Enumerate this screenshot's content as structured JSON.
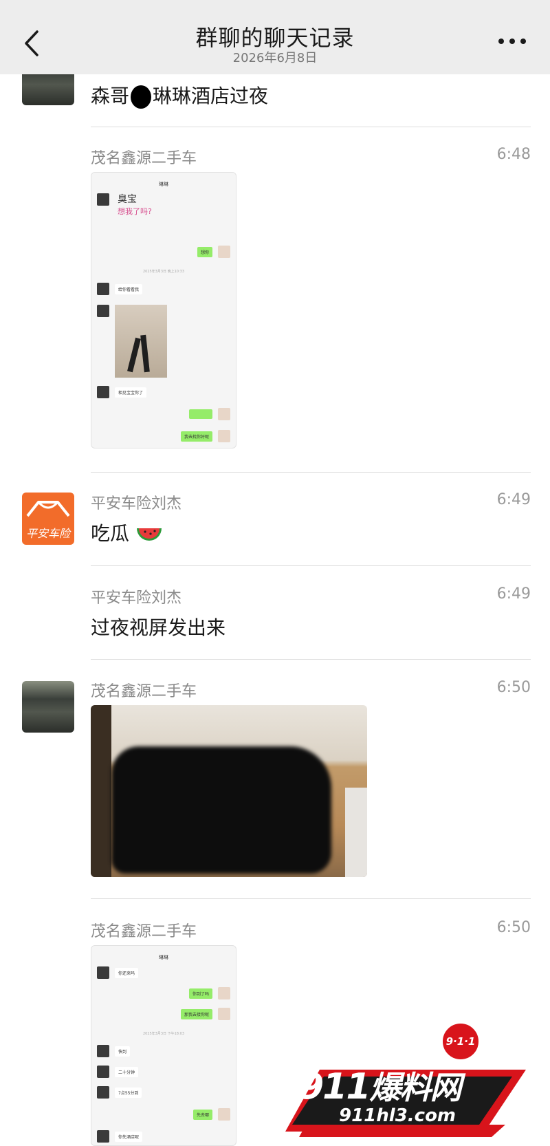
{
  "header": {
    "title": "群聊的聊天记录",
    "date": "2026年6月8日"
  },
  "messages": [
    {
      "text": "森哥",
      "text2": "琳琳酒店过夜"
    },
    {
      "sender": "茂名鑫源二手车",
      "time": "6:48",
      "screenshot": {
        "title": "琳琳",
        "sticker_line1": "臭宝",
        "sticker_line2": "想我了吗?",
        "bubbles": [
          "想你",
          "2025年3月3日 晚上10:33",
          "给你看看我",
          "相见宝宝你了",
          "",
          "我去找你好呢"
        ]
      }
    },
    {
      "sender": "平安车险刘杰",
      "time": "6:49",
      "text": "吃瓜",
      "avatar_text": "平安车险"
    },
    {
      "sender": "平安车险刘杰",
      "time": "6:49",
      "text": "过夜视屏发出来"
    },
    {
      "sender": "茂名鑫源二手车",
      "time": "6:50"
    },
    {
      "sender": "茂名鑫源二手车",
      "time": "6:50",
      "screenshot": {
        "title": "琳琳",
        "bubbles": [
          "你还来吗",
          "你到了吗",
          "那我去接你呢",
          "2025年3月3日 下午18:03",
          "快到",
          "二十分钟",
          "7点55分到",
          "先去哪",
          "你先酒店呢"
        ]
      }
    }
  ],
  "watermark": {
    "badge": "9·1·1",
    "brand_num": "911",
    "brand_cn": "爆料网",
    "url": "911hl3.com"
  },
  "colors": {
    "header_bg": "#ededed",
    "bubble_green": "#95ec69",
    "pingan_orange": "#f26c2a",
    "watermark_red": "#d8141b"
  }
}
